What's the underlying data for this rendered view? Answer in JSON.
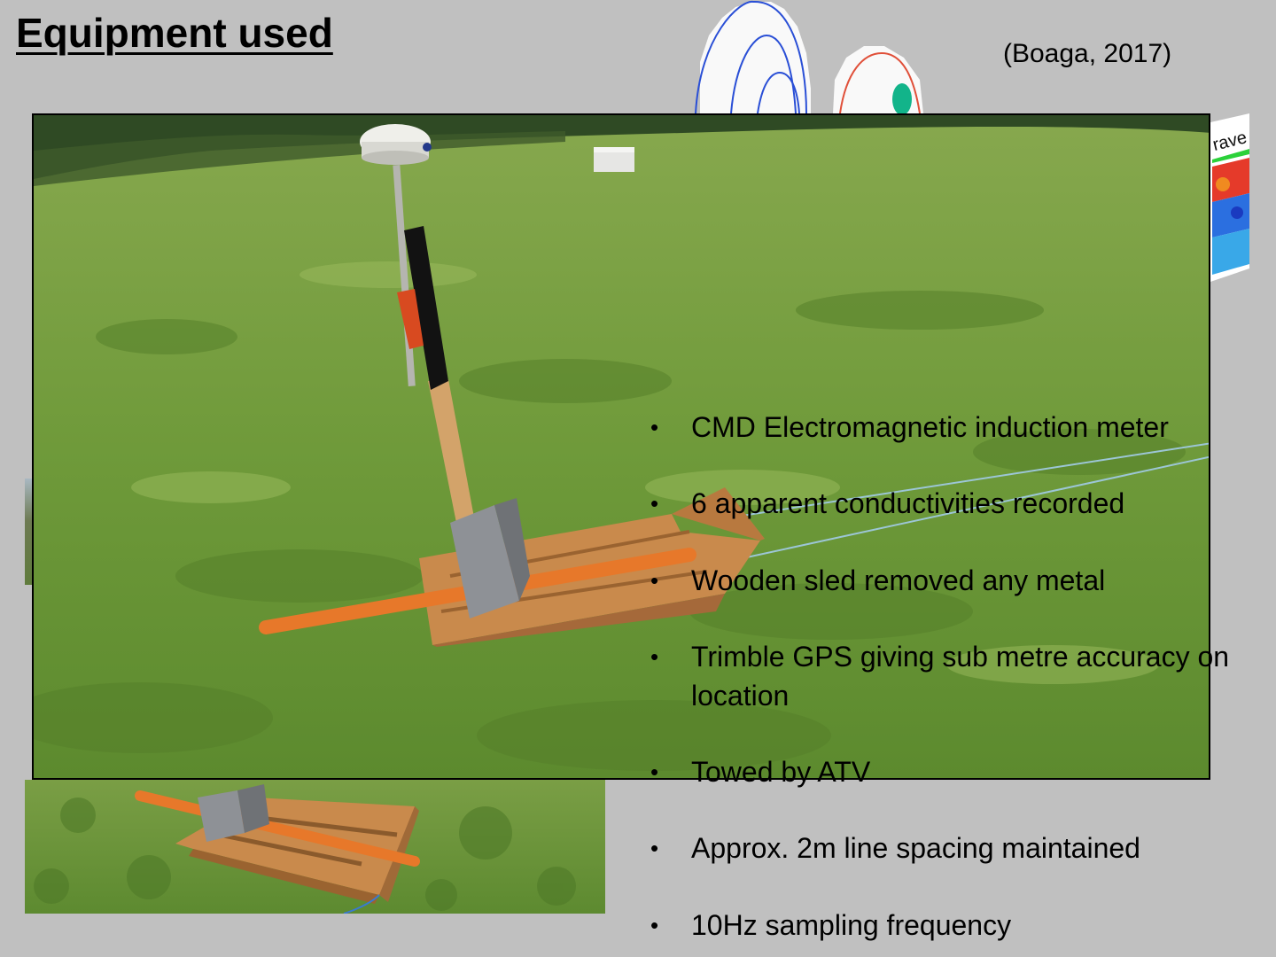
{
  "slide": {
    "title": "Equipment used",
    "citation": "(Boaga, 2017)",
    "section_fragment_text": "rave"
  },
  "bullets": [
    {
      "text": "CMD Electromagnetic induction meter"
    },
    {
      "text": "6 apparent conductivities recorded"
    },
    {
      "text": "Wooden sled removed any metal"
    },
    {
      "text": "Trimble GPS giving sub metre accuracy on location"
    },
    {
      "text": "Towed by ATV"
    },
    {
      "text": "Approx. 2m line spacing maintained"
    },
    {
      "text": "10Hz sampling frequency"
    }
  ],
  "colors": {
    "background": "#c0c0c0",
    "grass": "#6f9a3a",
    "wood": "#c8874a",
    "orange_pole": "#e7782a",
    "wave_blue": "#2a4fd6",
    "wave_red": "#e0503a",
    "teal_blob": "#12b48a"
  },
  "icons": {
    "bullet": "bullet-dot-icon"
  }
}
